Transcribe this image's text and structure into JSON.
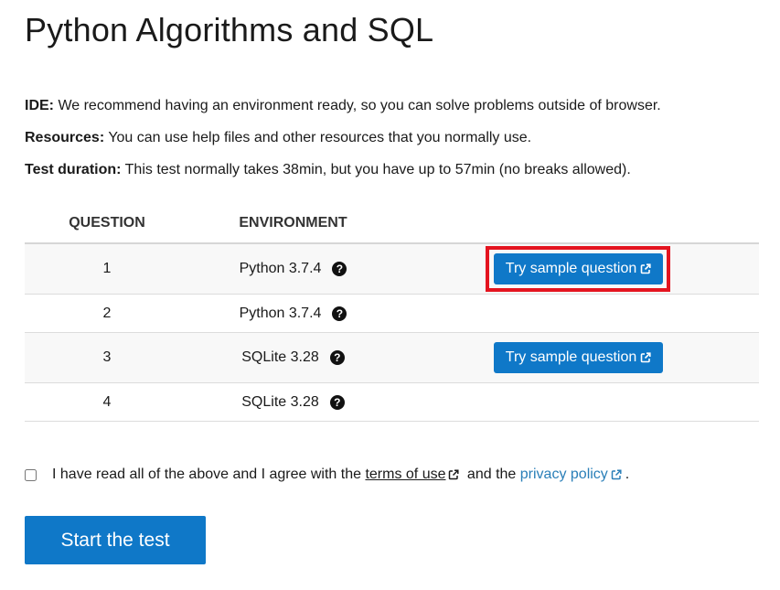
{
  "page": {
    "title": "Python Algorithms and SQL"
  },
  "info": {
    "ide_label": "IDE:",
    "ide_text": " We recommend having an environment ready, so you can solve problems outside of browser.",
    "resources_label": "Resources:",
    "resources_text": " You can use help files and other resources that you normally use.",
    "duration_label": "Test duration:",
    "duration_text": " This test normally takes 38min, but you have up to 57min (no breaks allowed)."
  },
  "table": {
    "headers": [
      "QUESTION",
      "ENVIRONMENT"
    ],
    "rows": [
      {
        "question": "1",
        "environment": "Python 3.7.4",
        "sample_label": "Try sample question"
      },
      {
        "question": "2",
        "environment": "Python 3.7.4",
        "sample_label": ""
      },
      {
        "question": "3",
        "environment": "SQLite 3.28",
        "sample_label": "Try sample question"
      },
      {
        "question": "4",
        "environment": "SQLite 3.28",
        "sample_label": ""
      }
    ]
  },
  "agreement": {
    "text_before": "I have read all of the above and I agree with the ",
    "terms_link": "terms of use",
    "text_middle": " and the ",
    "privacy_link": "privacy policy",
    "text_end": "."
  },
  "start_button": "Start the test",
  "icons": {
    "help": "question-circle-icon",
    "external": "external-link-icon"
  },
  "colors": {
    "primary": "#0f78c8",
    "highlight": "#e4141f",
    "link": "#2a7fb8",
    "row_alt": "#f8f8f8"
  }
}
